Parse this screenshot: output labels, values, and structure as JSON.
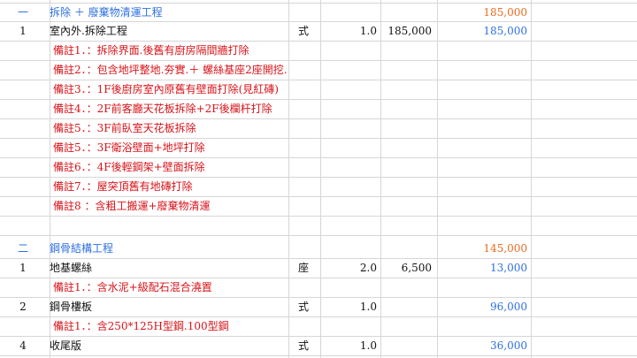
{
  "colors": {
    "section": "#2f6fe0",
    "note": "#d8141a",
    "subtotal": "#ea6a1e",
    "amount": "#2f6fe0"
  },
  "section1": {
    "no": "一",
    "title": "拆除 ＋ 廢棄物清運工程",
    "subtotal": "185,000",
    "item1": {
      "no": "1",
      "name": "室內外.拆除工程",
      "unit": "式",
      "qty": "1.0",
      "price": "185,000",
      "total": "185,000"
    },
    "notes": [
      "備註1．：拆除界面.後舊有廚房隔間牆打除",
      "備註2．：包含地坪整地.夯實.＋ 螺絲基座2座開挖.",
      "備註3．：1F後廚房室內原舊有壁面打除(見紅磚)",
      "備註4．：2F前客廳天花板拆除+2F後欄杆打除",
      "備註5．：3F前臥室天花板拆除",
      "備註5．：3F衛浴壁面+地坪打除",
      "備註6．：4F後輕鋼架+壁面拆除",
      "備註7．：屋突頂舊有地磚打除",
      "備註8 ：含粗工搬運+廢棄物清運"
    ]
  },
  "section2": {
    "no": "二",
    "title": "鋼骨結構工程",
    "subtotal": "145,000",
    "item1": {
      "no": "1",
      "name": "地基螺絲",
      "unit": "座",
      "qty": "2.0",
      "price": "6,500",
      "total": "13,000"
    },
    "note1": "備註1．：含水泥+級配石混合澆置",
    "item2": {
      "no": "2",
      "name": "鋼骨樓板",
      "unit": "式",
      "qty": "1.0",
      "price": "",
      "total": "96,000"
    },
    "note2": "備註1．：含250*125H型鋼.100型鋼",
    "item4": {
      "no": "4",
      "name": "收尾版",
      "unit": "式",
      "qty": "1.0",
      "price": "",
      "total": "36,000"
    }
  }
}
